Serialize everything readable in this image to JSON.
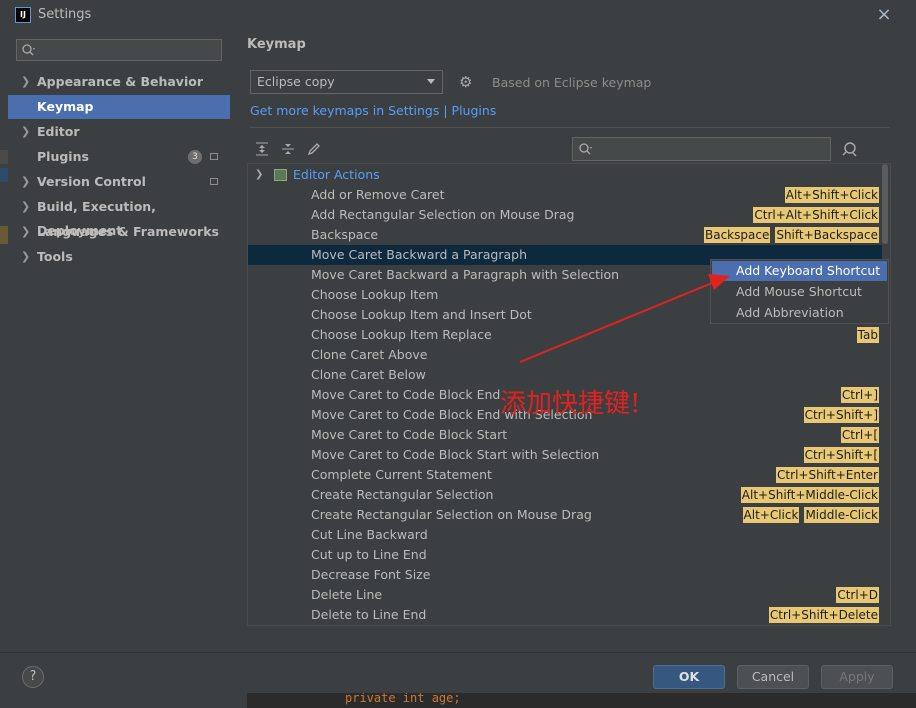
{
  "window": {
    "title": "Settings",
    "app_icon": "intellij-icon",
    "close": "×"
  },
  "sidebar": {
    "search_placeholder": "",
    "items": [
      {
        "label": "Appearance & Behavior",
        "expandable": true
      },
      {
        "label": "Keymap",
        "selected": true
      },
      {
        "label": "Editor",
        "expandable": true
      },
      {
        "label": "Plugins",
        "badge": "3"
      },
      {
        "label": "Version Control",
        "expandable": true
      },
      {
        "label": "Build, Execution, Deployment",
        "expandable": true
      },
      {
        "label": "Languages & Frameworks",
        "expandable": true
      },
      {
        "label": "Tools",
        "expandable": true
      }
    ]
  },
  "content": {
    "heading": "Keymap",
    "keymap_select": "Eclipse copy",
    "based_on": "Based on Eclipse keymap",
    "more_link": "Get more keymaps in Settings | Plugins",
    "search_placeholder": ""
  },
  "tree": {
    "group": "Editor Actions",
    "rows": [
      {
        "name": "Add or Remove Caret",
        "keys": [
          "Alt+Shift+Click"
        ]
      },
      {
        "name": "Add Rectangular Selection on Mouse Drag",
        "keys": [
          "Ctrl+Alt+Shift+Click"
        ]
      },
      {
        "name": "Backspace",
        "keys": [
          "Backspace",
          "Shift+Backspace"
        ]
      },
      {
        "name": "Move Caret Backward a Paragraph",
        "keys": [],
        "selected": true
      },
      {
        "name": "Move Caret Backward a Paragraph with Selection",
        "keys": []
      },
      {
        "name": "Choose Lookup Item",
        "keys": []
      },
      {
        "name": "Choose Lookup Item and Insert Dot",
        "keys": []
      },
      {
        "name": "Choose Lookup Item Replace",
        "keys": [
          "Tab"
        ]
      },
      {
        "name": "Clone Caret Above",
        "keys": []
      },
      {
        "name": "Clone Caret Below",
        "keys": []
      },
      {
        "name": "Move Caret to Code Block End",
        "keys": [
          "Ctrl+]"
        ]
      },
      {
        "name": "Move Caret to Code Block End with Selection",
        "keys": [
          "Ctrl+Shift+]"
        ]
      },
      {
        "name": "Move Caret to Code Block Start",
        "keys": [
          "Ctrl+["
        ]
      },
      {
        "name": "Move Caret to Code Block Start with Selection",
        "keys": [
          "Ctrl+Shift+["
        ]
      },
      {
        "name": "Complete Current Statement",
        "keys": [
          "Ctrl+Shift+Enter"
        ]
      },
      {
        "name": "Create Rectangular Selection",
        "keys": [
          "Alt+Shift+Middle-Click"
        ]
      },
      {
        "name": "Create Rectangular Selection on Mouse Drag",
        "keys": [
          "Alt+Click",
          "Middle-Click"
        ]
      },
      {
        "name": "Cut Line Backward",
        "keys": []
      },
      {
        "name": "Cut up to Line End",
        "keys": []
      },
      {
        "name": "Decrease Font Size",
        "keys": []
      },
      {
        "name": "Delete Line",
        "keys": [
          "Ctrl+D"
        ]
      },
      {
        "name": "Delete to Line End",
        "keys": [
          "Ctrl+Shift+Delete"
        ]
      }
    ]
  },
  "context_menu": {
    "items": [
      {
        "label": "Add Keyboard Shortcut",
        "selected": true
      },
      {
        "label": "Add Mouse Shortcut"
      },
      {
        "label": "Add Abbreviation"
      }
    ]
  },
  "annotation": "添加快捷键!",
  "buttons": {
    "help": "?",
    "ok": "OK",
    "cancel": "Cancel",
    "apply": "Apply"
  },
  "background_code": "private int age;",
  "colors": {
    "accent": "#4b6eaf",
    "shortcut_bg": "#e8c872",
    "link": "#589df6",
    "annotation": "#e0231f"
  }
}
